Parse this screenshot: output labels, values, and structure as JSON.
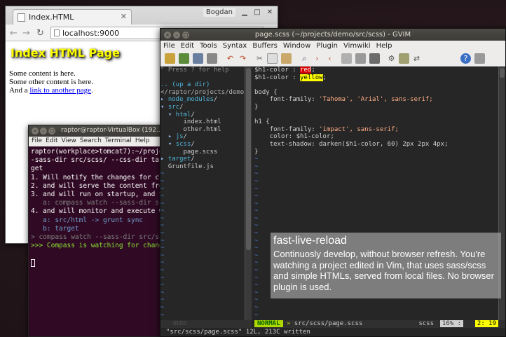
{
  "browser": {
    "tab_title": "Index.HTML",
    "user_label": "Bogdan",
    "url": "localhost:9000",
    "nav": {
      "back": "←",
      "forward": "→",
      "reload": "↻"
    },
    "page": {
      "heading": "Index HTML Page",
      "line1": "Some content is here.",
      "line2": "Some other content is here.",
      "line3_prefix": "And a ",
      "link_text": "link to another page",
      "line3_suffix": "."
    }
  },
  "terminal": {
    "title": "raptor@raptor-VirtualBox (192...",
    "menu": [
      "File",
      "Edit",
      "View",
      "Search",
      "Terminal",
      "Help"
    ],
    "lines": [
      "raptor(workplace>tomcat7):~/proje",
      "-sass-dir src/scss/ --css-dir tar",
      "get",
      "1. Will notify the changes for cl",
      "2. and will serve the content fro",
      "3. and will run on startup, and t",
      "   a: compass watch --sass-dir sr",
      "4. and will monitor and execute w",
      "   a: src/html -> grunt sync",
      "   b: target",
      "> compass watch --sass-dir src/sc",
      ">>> Compass is watching for chang"
    ]
  },
  "gvim": {
    "title": "page.scss (~/projects/demo/src/scss) - GVIM",
    "menu": [
      "File",
      "Edit",
      "Tools",
      "Syntax",
      "Buffers",
      "Window",
      "Plugin",
      "Vimwiki",
      "Help"
    ],
    "nerdtree": {
      "help": "\" Press ? for help",
      "up_dir": ".. (up a dir)",
      "root": "</raptor/projects/demo/",
      "status": "NERD"
    },
    "code": {
      "l1_var": "$h1-color",
      "l1_val": "red",
      "l2_var": "$h1-color",
      "l2_val": "yellow",
      "body_sel": "body {",
      "ff_prop": "font-family:",
      "ff_body_vals": "'Tahoma', 'Arial', sans-serif;",
      "close": "}",
      "h1_sel": "h1 {",
      "ff_h1_vals": "'impact', sans-serif;",
      "color_line": "color: $h1-color;",
      "shadow_prop": "text-shadow:",
      "shadow_val": "darken($h1-color, 60) 2px 2px 4px;"
    },
    "status": {
      "mode": "NORMAL",
      "arrow": "»",
      "file": "src/scss/page.scss",
      "filetype": "scss",
      "percent": "16% :",
      "position": "2: 19"
    },
    "cmdline": "\"src/scss/page.scss\" 12L, 213C written"
  },
  "caption": {
    "title": "fast-live-reload",
    "body": "Continuosly develop, without browser refresh. You're watching a project edited in Vim, that uses sass/scss and simple HTMLs, served from local files. No browser plugin is used."
  }
}
